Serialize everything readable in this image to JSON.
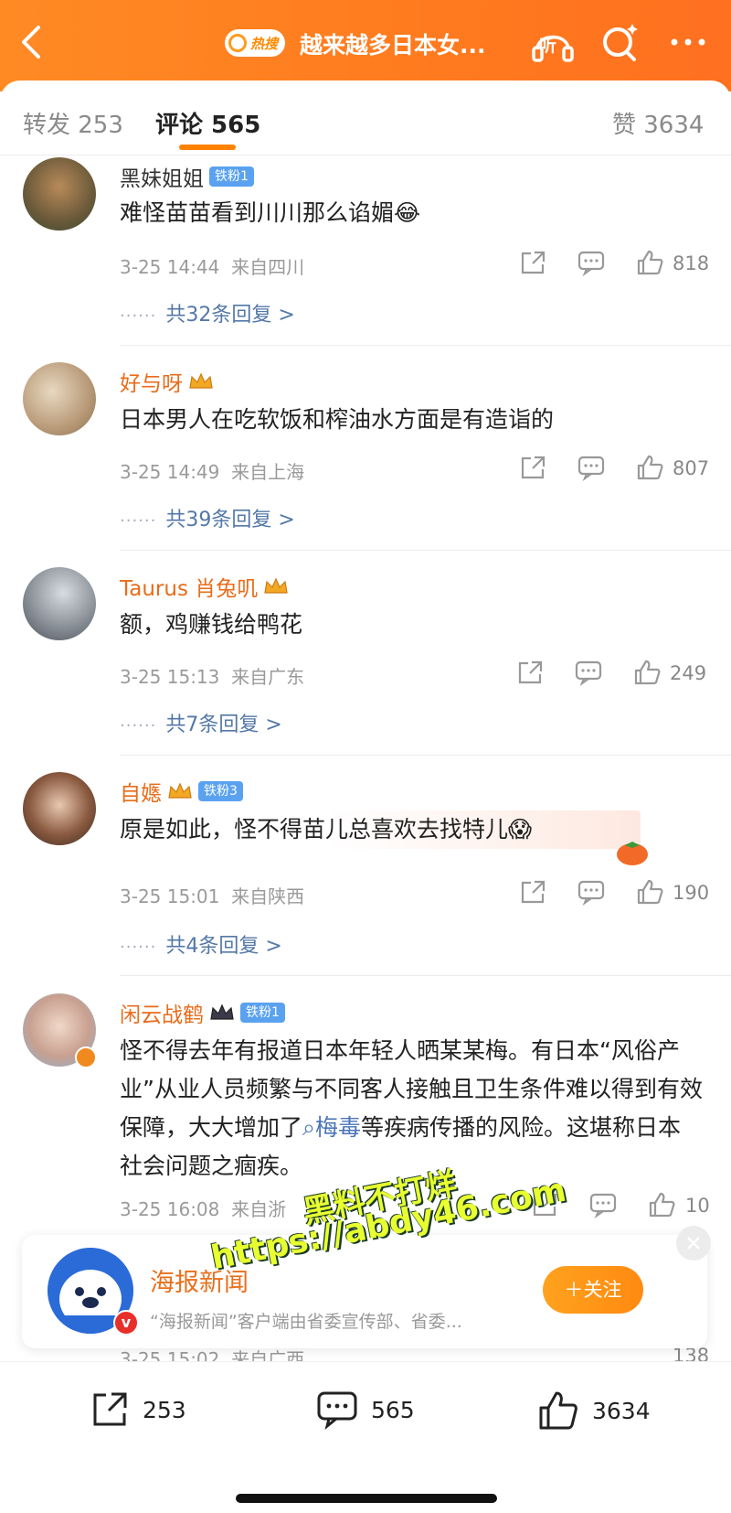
{
  "header": {
    "hot_badge": "热搜",
    "title": "越来越多日本女...",
    "listen_label": "听"
  },
  "tabs": {
    "repost": "转发 253",
    "comment": "评论 565",
    "like": "赞 3634"
  },
  "comments": [
    {
      "user": "黑妹姐姐",
      "badge": "铁粉1",
      "text": "难怪苗苗看到川川那么谄媚😂",
      "time": "3-25 14:44",
      "location": "来自四川",
      "likes": "818",
      "replies": "共32条回复 >"
    },
    {
      "user": "好与呀",
      "text": "日本男人在吃软饭和榨油水方面是有造诣的",
      "time": "3-25 14:49",
      "location": "来自上海",
      "likes": "807",
      "replies": "共39条回复 >"
    },
    {
      "user": "Taurus 肖兔叽",
      "text": "额，鸡赚钱给鸭花",
      "time": "3-25 15:13",
      "location": "来自广东",
      "likes": "249",
      "replies": "共7条回复 >"
    },
    {
      "user": "自嫕",
      "badge": "铁粉3",
      "text": "原是如此，怪不得苗儿总喜欢去找特儿😱",
      "time": "3-25 15:01",
      "location": "来自陕西",
      "likes": "190",
      "replies": "共4条回复 >"
    },
    {
      "user": "闲云战鹤",
      "badge": "铁粉1",
      "text_before": "怪不得去年有报道日本年轻人晒某某梅。有日本“风俗产业”从业人员频繁与不同客人接触且卫生条件难以得到有效保障，大大增加了",
      "topic": "梅毒",
      "text_after": "等疾病传播的风险。这堪称日本社会问题之痼疾。",
      "time": "3-25 16:08",
      "location": "来自浙",
      "likes": "10"
    },
    {
      "time": "3-25 15:02",
      "location": "来自广西",
      "likes": "138"
    }
  ],
  "watermark": {
    "line1": "黑料不打烊",
    "line2": "https://abdy46.com"
  },
  "promo": {
    "name": "海报新闻",
    "desc": "“海报新闻”客户端由省委宣传部、省委...",
    "follow": "＋关注"
  },
  "bottom_bar": {
    "reposts": "253",
    "comments": "565",
    "likes": "3634"
  },
  "colors": {
    "brand_orange": "#ff8200",
    "link_blue": "#5478a8",
    "fan_badge": "#5aa2f0"
  }
}
